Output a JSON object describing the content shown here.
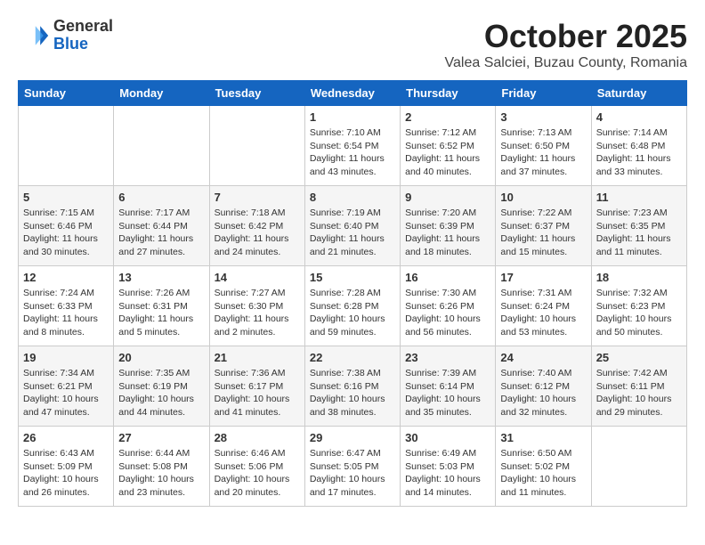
{
  "header": {
    "logo_general": "General",
    "logo_blue": "Blue",
    "month": "October 2025",
    "location": "Valea Salciei, Buzau County, Romania"
  },
  "weekdays": [
    "Sunday",
    "Monday",
    "Tuesday",
    "Wednesday",
    "Thursday",
    "Friday",
    "Saturday"
  ],
  "weeks": [
    [
      {
        "day": "",
        "info": ""
      },
      {
        "day": "",
        "info": ""
      },
      {
        "day": "",
        "info": ""
      },
      {
        "day": "1",
        "info": "Sunrise: 7:10 AM\nSunset: 6:54 PM\nDaylight: 11 hours and 43 minutes."
      },
      {
        "day": "2",
        "info": "Sunrise: 7:12 AM\nSunset: 6:52 PM\nDaylight: 11 hours and 40 minutes."
      },
      {
        "day": "3",
        "info": "Sunrise: 7:13 AM\nSunset: 6:50 PM\nDaylight: 11 hours and 37 minutes."
      },
      {
        "day": "4",
        "info": "Sunrise: 7:14 AM\nSunset: 6:48 PM\nDaylight: 11 hours and 33 minutes."
      }
    ],
    [
      {
        "day": "5",
        "info": "Sunrise: 7:15 AM\nSunset: 6:46 PM\nDaylight: 11 hours and 30 minutes."
      },
      {
        "day": "6",
        "info": "Sunrise: 7:17 AM\nSunset: 6:44 PM\nDaylight: 11 hours and 27 minutes."
      },
      {
        "day": "7",
        "info": "Sunrise: 7:18 AM\nSunset: 6:42 PM\nDaylight: 11 hours and 24 minutes."
      },
      {
        "day": "8",
        "info": "Sunrise: 7:19 AM\nSunset: 6:40 PM\nDaylight: 11 hours and 21 minutes."
      },
      {
        "day": "9",
        "info": "Sunrise: 7:20 AM\nSunset: 6:39 PM\nDaylight: 11 hours and 18 minutes."
      },
      {
        "day": "10",
        "info": "Sunrise: 7:22 AM\nSunset: 6:37 PM\nDaylight: 11 hours and 15 minutes."
      },
      {
        "day": "11",
        "info": "Sunrise: 7:23 AM\nSunset: 6:35 PM\nDaylight: 11 hours and 11 minutes."
      }
    ],
    [
      {
        "day": "12",
        "info": "Sunrise: 7:24 AM\nSunset: 6:33 PM\nDaylight: 11 hours and 8 minutes."
      },
      {
        "day": "13",
        "info": "Sunrise: 7:26 AM\nSunset: 6:31 PM\nDaylight: 11 hours and 5 minutes."
      },
      {
        "day": "14",
        "info": "Sunrise: 7:27 AM\nSunset: 6:30 PM\nDaylight: 11 hours and 2 minutes."
      },
      {
        "day": "15",
        "info": "Sunrise: 7:28 AM\nSunset: 6:28 PM\nDaylight: 10 hours and 59 minutes."
      },
      {
        "day": "16",
        "info": "Sunrise: 7:30 AM\nSunset: 6:26 PM\nDaylight: 10 hours and 56 minutes."
      },
      {
        "day": "17",
        "info": "Sunrise: 7:31 AM\nSunset: 6:24 PM\nDaylight: 10 hours and 53 minutes."
      },
      {
        "day": "18",
        "info": "Sunrise: 7:32 AM\nSunset: 6:23 PM\nDaylight: 10 hours and 50 minutes."
      }
    ],
    [
      {
        "day": "19",
        "info": "Sunrise: 7:34 AM\nSunset: 6:21 PM\nDaylight: 10 hours and 47 minutes."
      },
      {
        "day": "20",
        "info": "Sunrise: 7:35 AM\nSunset: 6:19 PM\nDaylight: 10 hours and 44 minutes."
      },
      {
        "day": "21",
        "info": "Sunrise: 7:36 AM\nSunset: 6:17 PM\nDaylight: 10 hours and 41 minutes."
      },
      {
        "day": "22",
        "info": "Sunrise: 7:38 AM\nSunset: 6:16 PM\nDaylight: 10 hours and 38 minutes."
      },
      {
        "day": "23",
        "info": "Sunrise: 7:39 AM\nSunset: 6:14 PM\nDaylight: 10 hours and 35 minutes."
      },
      {
        "day": "24",
        "info": "Sunrise: 7:40 AM\nSunset: 6:12 PM\nDaylight: 10 hours and 32 minutes."
      },
      {
        "day": "25",
        "info": "Sunrise: 7:42 AM\nSunset: 6:11 PM\nDaylight: 10 hours and 29 minutes."
      }
    ],
    [
      {
        "day": "26",
        "info": "Sunrise: 6:43 AM\nSunset: 5:09 PM\nDaylight: 10 hours and 26 minutes."
      },
      {
        "day": "27",
        "info": "Sunrise: 6:44 AM\nSunset: 5:08 PM\nDaylight: 10 hours and 23 minutes."
      },
      {
        "day": "28",
        "info": "Sunrise: 6:46 AM\nSunset: 5:06 PM\nDaylight: 10 hours and 20 minutes."
      },
      {
        "day": "29",
        "info": "Sunrise: 6:47 AM\nSunset: 5:05 PM\nDaylight: 10 hours and 17 minutes."
      },
      {
        "day": "30",
        "info": "Sunrise: 6:49 AM\nSunset: 5:03 PM\nDaylight: 10 hours and 14 minutes."
      },
      {
        "day": "31",
        "info": "Sunrise: 6:50 AM\nSunset: 5:02 PM\nDaylight: 10 hours and 11 minutes."
      },
      {
        "day": "",
        "info": ""
      }
    ]
  ]
}
